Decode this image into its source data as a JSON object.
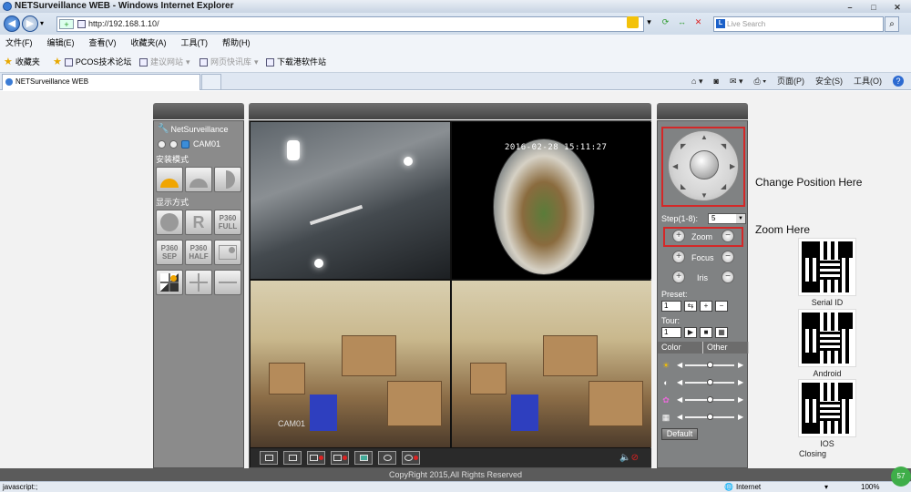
{
  "window": {
    "title": "NETSurveillance WEB - Windows Internet Explorer",
    "min": "–",
    "max": "□",
    "close": "✕"
  },
  "address": {
    "url": "http://192.168.1.10/",
    "search_placeholder": "Live Search"
  },
  "menu": [
    "文件(F)",
    "编辑(E)",
    "查看(V)",
    "收藏夹(A)",
    "工具(T)",
    "帮助(H)"
  ],
  "favbar": {
    "favorites": "收藏夹",
    "items": [
      "PCOS技术论坛",
      "建议网站",
      "网页快讯库",
      "下载港软件站"
    ]
  },
  "tab": {
    "title": "NETSurveillance WEB"
  },
  "tabtools": {
    "page": "页面(P)",
    "safety": "安全(S)",
    "tools": "工具(O)",
    "help": "?"
  },
  "left": {
    "app": "NetSurveillance",
    "cam": "CAM01",
    "install_mode": "安装模式",
    "display_mode": "显示方式",
    "btn_p360full": [
      "P360",
      "FULL"
    ],
    "btn_p360sep": [
      "P360",
      "SEP"
    ],
    "btn_p360half": [
      "P360",
      "HALF"
    ],
    "btn_r": "R"
  },
  "video": {
    "timestamp": "2016-02-28 15:11:27",
    "cam_label": "CAM01"
  },
  "right": {
    "step_label": "Step(1-8):",
    "step_value": "5",
    "zoom": "Zoom",
    "focus": "Focus",
    "iris": "Iris",
    "preset_label": "Preset:",
    "preset_value": "1",
    "tour_label": "Tour:",
    "tour_value": "1",
    "tab_color": "Color",
    "tab_other": "Other",
    "default_btn": "Default"
  },
  "annotations": {
    "change_position": "Change Position Here",
    "zoom_here": "Zoom Here",
    "serial_id": "Serial ID",
    "android": "Android",
    "ios": "IOS",
    "closing": "Closing"
  },
  "footer": {
    "copyright": "CopyRight 2015,All Rights Reserved"
  },
  "status": {
    "left": "javascript:;",
    "zone": "Internet",
    "zoom": "100%",
    "badge": "57"
  }
}
